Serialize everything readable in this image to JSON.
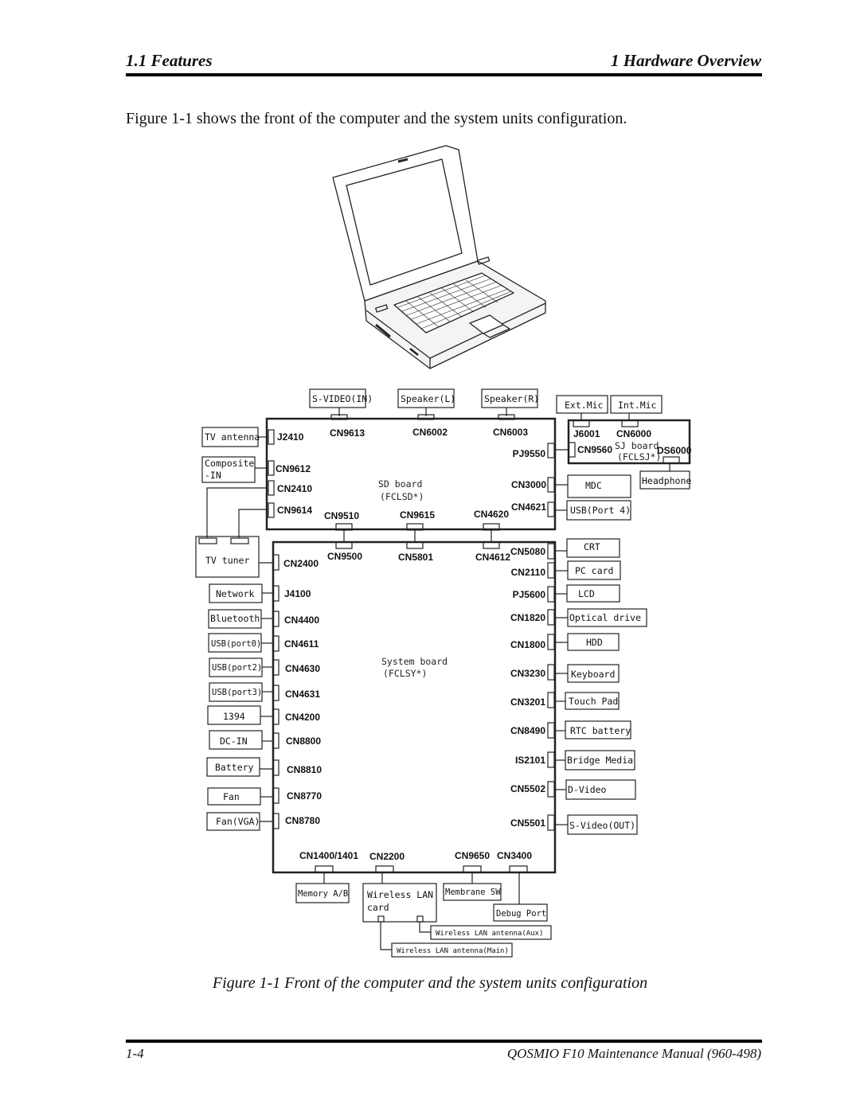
{
  "header": {
    "section": "1.1  Features",
    "chapter": "1  Hardware Overview"
  },
  "intro_text": "Figure 1-1 shows the front of the computer and the system units configuration.",
  "figure": {
    "illustration": "laptop-front-view",
    "sd_board": {
      "name": "SD board",
      "code": "(FCLSD*)",
      "connectors": {
        "top": [
          "CN9613",
          "CN6002",
          "CN6003"
        ],
        "left": [
          "J2410",
          "CN9612",
          "CN2410",
          "CN9614"
        ],
        "right": [
          "PJ9550",
          "CN3000",
          "CN4621"
        ],
        "bottom": [
          "CN9510",
          "CN9615",
          "CN4620"
        ]
      }
    },
    "sj_board": {
      "name": "SJ board",
      "code": "(FCLSJ*)",
      "connectors": [
        "J6001",
        "CN6000",
        "CN9560",
        "DS6000"
      ]
    },
    "system_board": {
      "name": "System board",
      "code": "(FCLSY*)",
      "connectors": {
        "top": [
          "CN9500",
          "CN5801",
          "CN4612"
        ],
        "left": [
          "CN2400",
          "J4100",
          "CN4400",
          "CN4611",
          "CN4630",
          "CN4631",
          "CN4200",
          "CN8800",
          "CN8810",
          "CN8770",
          "CN8780"
        ],
        "right": [
          "CN5080",
          "CN2110",
          "PJ5600",
          "CN1820",
          "CN1800",
          "CN3230",
          "CN3201",
          "CN8490",
          "IS2101",
          "CN5502",
          "CN5501"
        ],
        "bottom": [
          "CN1400/1401",
          "CN2200",
          "CN9650",
          "CN3400"
        ]
      }
    },
    "units": {
      "s_video_in": "S-VIDEO(IN)",
      "speaker_l": "Speaker(L)",
      "speaker_r": "Speaker(R)",
      "ext_mic": "Ext.Mic",
      "int_mic": "Int.Mic",
      "tv_antenna": "TV antenna",
      "composite_in_1": "Composite",
      "composite_in_2": "-IN",
      "mdc": "MDC",
      "usb_port4": "USB(Port 4)",
      "headphone": "Headphone",
      "tv_tuner": "TV tuner",
      "network": "Network",
      "bluetooth": "Bluetooth",
      "usb_port0": "USB(port0)",
      "usb_port2": "USB(port2)",
      "usb_port3": "USB(port3)",
      "ieee1394": "1394",
      "dc_in": "DC-IN",
      "battery": "Battery",
      "fan": "Fan",
      "fan_vga": "Fan(VGA)",
      "crt": "CRT",
      "pc_card": "PC card",
      "lcd": "LCD",
      "optical_drive": "Optical drive",
      "hdd": "HDD",
      "keyboard": "Keyboard",
      "touch_pad": "Touch Pad",
      "rtc_battery": "RTC battery",
      "bridge_media": "Bridge Media",
      "d_video": "D-Video",
      "s_video_out": "S-Video(OUT)",
      "memory": "Memory A/B",
      "wlan_card_1": "Wireless LAN",
      "wlan_card_2": "card",
      "membrane_sw": "Membrane SW",
      "debug_port": "Debug Port",
      "wlan_antenna_aux": "Wireless LAN antenna(Aux)",
      "wlan_antenna_main": "Wireless LAN antenna(Main)"
    }
  },
  "caption": "Figure 1-1 Front of the computer and the system units configuration",
  "footer": {
    "page": "1-4",
    "manual": "QOSMIO F10  Maintenance Manual (960-498)"
  }
}
